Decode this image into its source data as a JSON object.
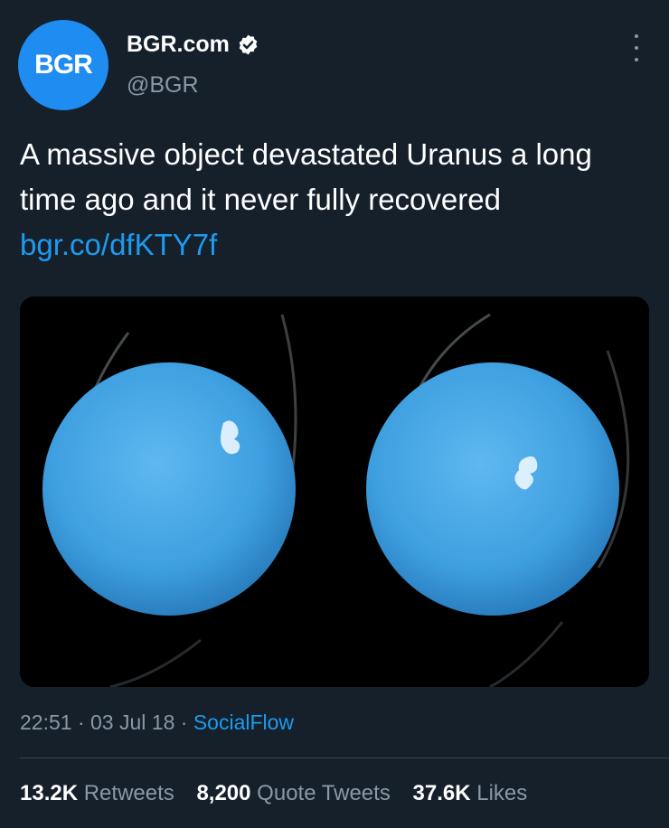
{
  "colors": {
    "background": "#15202b",
    "avatar": "#1e8cf0",
    "link": "#1d9bf0",
    "secondary_text": "#8b98a5",
    "planet": "#4aa8e8"
  },
  "author": {
    "avatar_text": "BGR",
    "display_name": "BGR.com",
    "verified_icon": "verified-badge-icon",
    "handle": "@BGR"
  },
  "menu": {
    "icon": "more-vertical-icon"
  },
  "tweet": {
    "text": "A massive object devastated Uranus a long time ago and it never fully recovered",
    "link": "bgr.co/dfKTY7f"
  },
  "meta": {
    "time": "22:51",
    "separator1": " · ",
    "date": "03 Jul 18",
    "separator2": " · ",
    "source": "SocialFlow"
  },
  "stats": {
    "retweets_count": "13.2K",
    "retweets_label": "Retweets",
    "quotes_count": "8,200",
    "quotes_label": "Quote Tweets",
    "likes_count": "37.6K",
    "likes_label": "Likes"
  }
}
